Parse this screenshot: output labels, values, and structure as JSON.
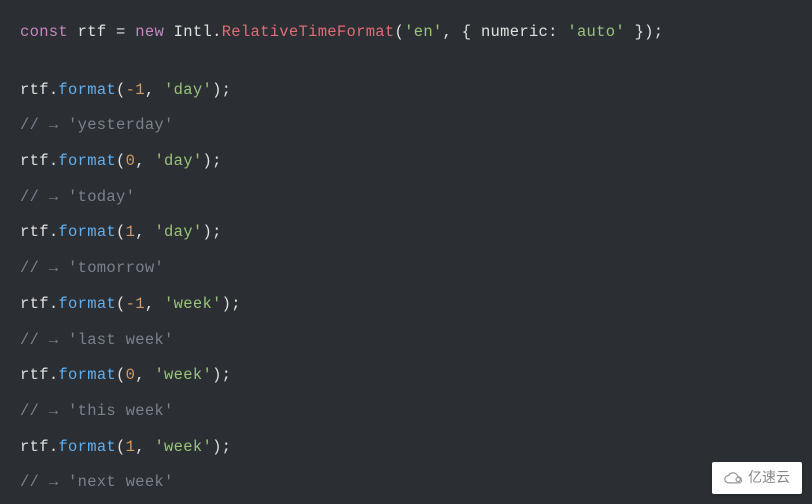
{
  "code": {
    "line1": {
      "const": "const",
      "rtf": "rtf",
      "eq": " = ",
      "new": "new",
      "intl": " Intl",
      "dot1": ".",
      "rel": "RelativeTimeFormat",
      "open": "(",
      "locale": "'en'",
      "comma": ", { ",
      "numeric": "numeric",
      "colon": ": ",
      "auto": "'auto'",
      "close": " });"
    },
    "calls": [
      {
        "obj": "rtf",
        "dot": ".",
        "method": "format",
        "open": "(",
        "arg1": "-1",
        "comma": ", ",
        "arg2": "'day'",
        "close": ");",
        "comment": "// → 'yesterday'"
      },
      {
        "obj": "rtf",
        "dot": ".",
        "method": "format",
        "open": "(",
        "arg1": "0",
        "comma": ", ",
        "arg2": "'day'",
        "close": ");",
        "comment": "// → 'today'"
      },
      {
        "obj": "rtf",
        "dot": ".",
        "method": "format",
        "open": "(",
        "arg1": "1",
        "comma": ", ",
        "arg2": "'day'",
        "close": ");",
        "comment": "// → 'tomorrow'"
      },
      {
        "obj": "rtf",
        "dot": ".",
        "method": "format",
        "open": "(",
        "arg1": "-1",
        "comma": ", ",
        "arg2": "'week'",
        "close": ");",
        "comment": "// → 'last week'"
      },
      {
        "obj": "rtf",
        "dot": ".",
        "method": "format",
        "open": "(",
        "arg1": "0",
        "comma": ", ",
        "arg2": "'week'",
        "close": ");",
        "comment": "// → 'this week'"
      },
      {
        "obj": "rtf",
        "dot": ".",
        "method": "format",
        "open": "(",
        "arg1": "1",
        "comma": ", ",
        "arg2": "'week'",
        "close": ");",
        "comment": "// → 'next week'"
      }
    ],
    "watermark": "亿速云"
  }
}
